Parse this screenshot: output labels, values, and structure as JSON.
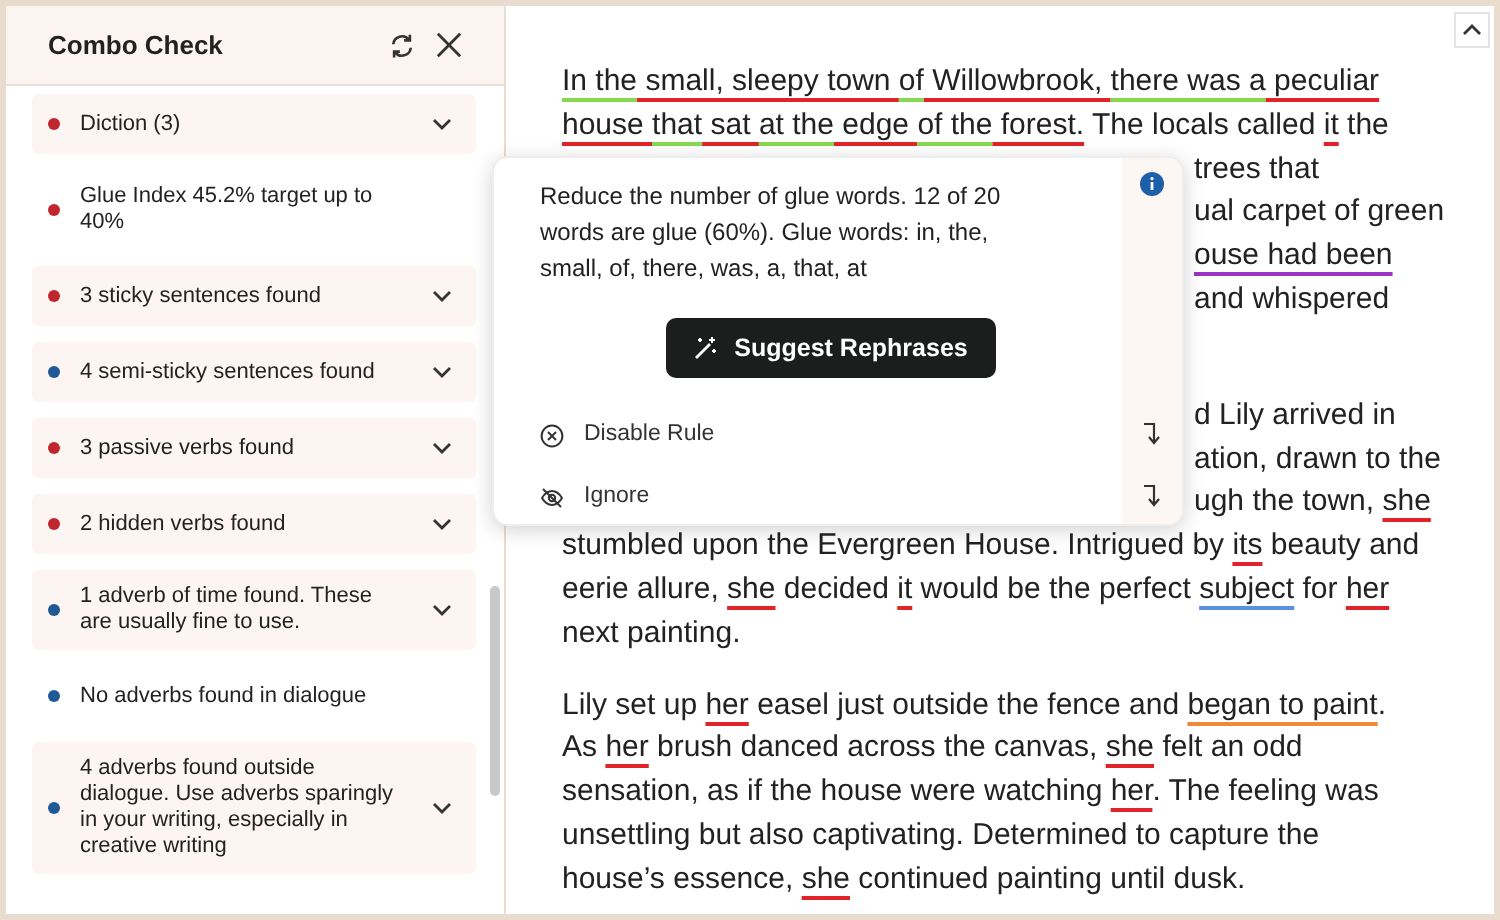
{
  "panel": {
    "title": "Combo Check",
    "items": [
      {
        "text": "Diction (3)",
        "color": "#c0262d",
        "expandable": true
      },
      {
        "text": "Glue Index 45.2% target up to 40%",
        "color": "#c0262d",
        "expandable": false
      },
      {
        "text": "3 sticky sentences found",
        "color": "#c0262d",
        "expandable": true
      },
      {
        "text": "4 semi-sticky sentences found",
        "color": "#1f5a96",
        "expandable": true
      },
      {
        "text": "3 passive verbs found",
        "color": "#c0262d",
        "expandable": true
      },
      {
        "text": "2 hidden verbs found",
        "color": "#c0262d",
        "expandable": true
      },
      {
        "text": "1 adverb of time found. These are usually fine to use.",
        "color": "#1f5a96",
        "expandable": true
      },
      {
        "text": "No adverbs found in dialogue",
        "color": "#1f5a96",
        "expandable": false
      },
      {
        "text": "4 adverbs found outside dialogue. Use adverbs sparingly in your writing, especially in creative writing",
        "color": "#1f5a96",
        "expandable": true
      }
    ]
  },
  "popup": {
    "message": "Reduce the number of glue words. 12 of 20 words are glue (60%). Glue words: in, the, small, of, there, was, a, that, at",
    "action_button": "Suggest Rephrases",
    "options": [
      {
        "label": "Disable Rule",
        "kind": "disable"
      },
      {
        "label": "Ignore",
        "kind": "ignore"
      }
    ]
  },
  "document": {
    "paragraphs": [
      {
        "lines": [
          {
            "kind": "full",
            "segments": [
              {
                "text": "In the",
                "kind": "glue"
              },
              {
                "text": " small, sleepy town ",
                "kind": "sticky"
              },
              {
                "text": "of",
                "kind": "glue"
              },
              {
                "text": " Willowbrook, ",
                "kind": "sticky"
              },
              {
                "text": "there was a",
                "kind": "glue"
              },
              {
                "text": " peculiar",
                "kind": "sticky"
              }
            ]
          },
          {
            "kind": "full",
            "segments": [
              {
                "text": "house ",
                "kind": "sticky"
              },
              {
                "text": "that",
                "kind": "glue"
              },
              {
                "text": " sat ",
                "kind": "sticky"
              },
              {
                "text": "at the",
                "kind": "glue"
              },
              {
                "text": " edge ",
                "kind": "sticky"
              },
              {
                "text": "of the",
                "kind": "glue"
              },
              {
                "text": " forest.",
                "kind": "sticky"
              },
              {
                "text": " The locals called ",
                "kind": "plain"
              },
              {
                "text": "it",
                "kind": "pronoun"
              },
              {
                "text": " the",
                "kind": "plain"
              }
            ]
          },
          {
            "kind": "partial",
            "segments": [
              {
                "text": "trees that",
                "kind": "plain"
              }
            ]
          },
          {
            "kind": "partial",
            "segments": [
              {
                "text": "ual carpet of green",
                "kind": "plain"
              }
            ]
          },
          {
            "kind": "partial",
            "segments": [
              {
                "text": "ouse had been",
                "kind": "passive"
              }
            ]
          },
          {
            "kind": "partial",
            "segments": [
              {
                "text": "and whispered",
                "kind": "plain"
              }
            ]
          }
        ]
      },
      {
        "lines": [
          {
            "kind": "partial",
            "segments": [
              {
                "text": "d Lily arrived in",
                "kind": "plain"
              }
            ]
          },
          {
            "kind": "partial",
            "segments": [
              {
                "text": "ation, drawn to the",
                "kind": "plain"
              }
            ]
          },
          {
            "kind": "partial",
            "segments": [
              {
                "text": "ugh the town, ",
                "kind": "plain"
              },
              {
                "text": "she",
                "kind": "pronoun"
              }
            ]
          },
          {
            "kind": "full",
            "segments": [
              {
                "text": "stumbled upon the Evergreen House. Intrigued by ",
                "kind": "plain"
              },
              {
                "text": "its",
                "kind": "pronoun"
              },
              {
                "text": " beauty and",
                "kind": "plain"
              }
            ]
          },
          {
            "kind": "full",
            "segments": [
              {
                "text": "eerie allure, ",
                "kind": "plain"
              },
              {
                "text": "she",
                "kind": "pronoun"
              },
              {
                "text": " decided ",
                "kind": "plain"
              },
              {
                "text": "it",
                "kind": "pronoun"
              },
              {
                "text": " would be the perfect ",
                "kind": "plain"
              },
              {
                "text": "subject",
                "kind": "adverb"
              },
              {
                "text": " for ",
                "kind": "plain"
              },
              {
                "text": "her",
                "kind": "pronoun"
              }
            ]
          },
          {
            "kind": "full",
            "segments": [
              {
                "text": "next painting.",
                "kind": "plain"
              }
            ]
          }
        ]
      },
      {
        "lines": [
          {
            "kind": "full",
            "segments": [
              {
                "text": "Lily set up ",
                "kind": "plain"
              },
              {
                "text": "her",
                "kind": "pronoun"
              },
              {
                "text": " easel just outside the fence and ",
                "kind": "plain"
              },
              {
                "text": "began to paint",
                "kind": "hidden"
              },
              {
                "text": ".",
                "kind": "plain"
              }
            ]
          },
          {
            "kind": "full",
            "segments": [
              {
                "text": "As ",
                "kind": "plain"
              },
              {
                "text": "her",
                "kind": "pronoun"
              },
              {
                "text": " brush danced across the canvas, ",
                "kind": "plain"
              },
              {
                "text": "she",
                "kind": "pronoun"
              },
              {
                "text": " felt an odd",
                "kind": "plain"
              }
            ]
          },
          {
            "kind": "full",
            "segments": [
              {
                "text": "sensation, as if the house were watching ",
                "kind": "plain"
              },
              {
                "text": "her",
                "kind": "pronoun"
              },
              {
                "text": ". The feeling was",
                "kind": "plain"
              }
            ]
          },
          {
            "kind": "full",
            "segments": [
              {
                "text": "unsettling but also captivating. Determined to capture the",
                "kind": "plain"
              }
            ]
          },
          {
            "kind": "full",
            "segments": [
              {
                "text": "house’s essence, ",
                "kind": "plain"
              },
              {
                "text": "she",
                "kind": "pronoun"
              },
              {
                "text": " continued painting until dusk.",
                "kind": "plain"
              }
            ]
          }
        ]
      }
    ]
  }
}
